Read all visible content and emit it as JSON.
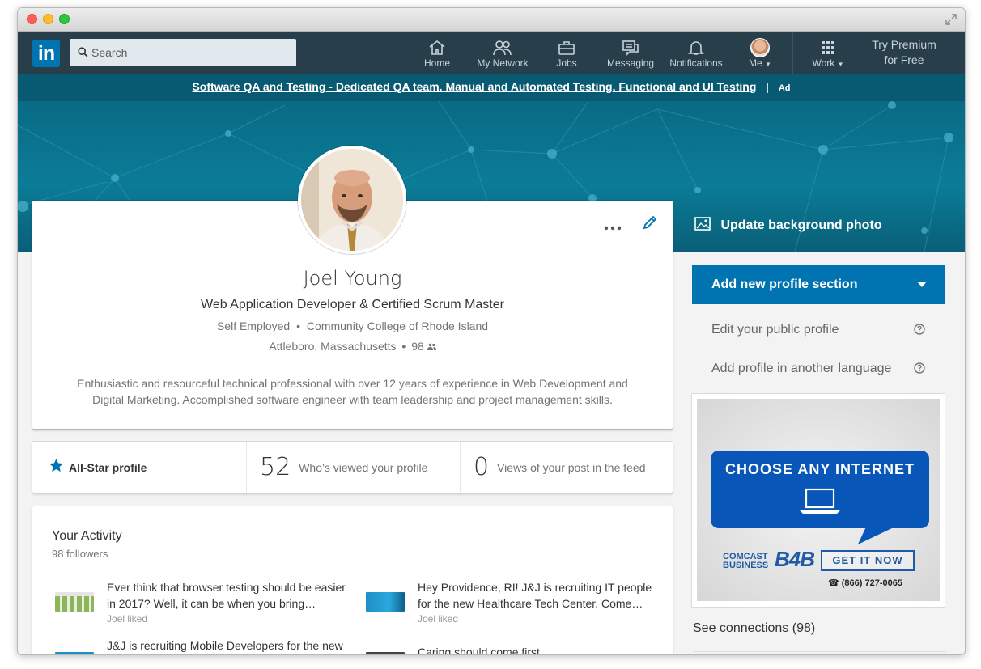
{
  "nav": {
    "search_placeholder": "Search",
    "items": [
      {
        "label": "Home",
        "icon": "home-icon"
      },
      {
        "label": "My Network",
        "icon": "network-icon"
      },
      {
        "label": "Jobs",
        "icon": "briefcase-icon"
      },
      {
        "label": "Messaging",
        "icon": "messaging-icon"
      },
      {
        "label": "Notifications",
        "icon": "bell-icon"
      },
      {
        "label": "Me",
        "icon": "avatar"
      },
      {
        "label": "Work",
        "icon": "grid-icon"
      }
    ],
    "premium_line1": "Try Premium",
    "premium_line2": "for Free",
    "logo_text": "in"
  },
  "ad_strip": {
    "link_text": "Software QA and Testing - Dedicated QA team. Manual and Automated Testing. Functional and UI Testing",
    "separator": "|",
    "tag": "Ad"
  },
  "banner": {
    "update_label": "Update background photo"
  },
  "profile": {
    "name": "Joel Young",
    "headline": "Web Application Developer & Certified Scrum Master",
    "company": "Self Employed",
    "bullet": "•",
    "education": "Community College of Rhode Island",
    "location": "Attleboro, Massachusetts",
    "connections": "98",
    "summary": "Enthusiastic and resourceful technical professional with over 12 years of experience in Web Development and Digital Marketing. Accomplished software engineer with team leadership and project management skills."
  },
  "stats": {
    "allstar_label": "All-Star profile",
    "views_count": "52",
    "views_label": "Who’s viewed your profile",
    "post_views_count": "0",
    "post_views_label": "Views of your post in the feed"
  },
  "activity": {
    "title": "Your Activity",
    "followers": "98 followers",
    "posts": [
      {
        "text": "Ever think that browser testing should be easier in 2017? Well, it can be when you bring…",
        "meta": "Joel liked"
      },
      {
        "text": "Hey Providence, RI! J&J is recruiting IT people for the new Healthcare Tech Center. Come…",
        "meta": "Joel liked"
      },
      {
        "text": "J&J is recruiting Mobile Developers for the new",
        "meta": ""
      },
      {
        "text": "Caring should come first",
        "meta": ""
      }
    ]
  },
  "rail": {
    "add_section": "Add new profile section",
    "edit_public": "Edit your public profile",
    "add_language": "Add profile in another language",
    "see_connections": "See connections (98)"
  },
  "side_ad": {
    "headline": "CHOOSE ANY INTERNET",
    "brand_line1": "COMCAST",
    "brand_line2": "BUSINESS",
    "brand_mark": "B4B",
    "cta": "GET IT NOW",
    "phone": "(866) 727-0065"
  },
  "colors": {
    "nav_bg": "#283e4a",
    "brand_blue": "#0073b1",
    "banner_teal": "#0a6a85",
    "ad_blue": "#0857b8"
  }
}
